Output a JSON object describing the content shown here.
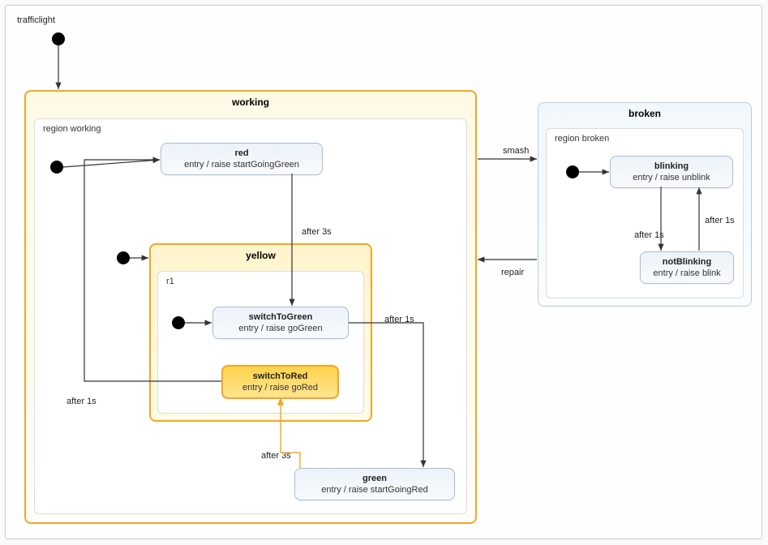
{
  "diagram": {
    "title": "trafficlight"
  },
  "working": {
    "title": "working",
    "region": "region working",
    "red": {
      "name": "red",
      "entry": "entry / raise startGoingGreen"
    },
    "yellow": {
      "title": "yellow",
      "region": "r1",
      "switchToGreen": {
        "name": "switchToGreen",
        "entry": "entry / raise goGreen"
      },
      "switchToRed": {
        "name": "switchToRed",
        "entry": "entry / raise goRed"
      }
    },
    "green": {
      "name": "green",
      "entry": "entry / raise startGoingRed"
    }
  },
  "broken": {
    "title": "broken",
    "region": "region broken",
    "blinking": {
      "name": "blinking",
      "entry": "entry / raise unblink"
    },
    "notBlinking": {
      "name": "notBlinking",
      "entry": "entry / raise blink"
    }
  },
  "transitions": {
    "red_to_yellow": "after 3s",
    "yellow_to_green": "after 1s",
    "green_to_yellow": "after 3s",
    "yellow_to_red": "after 1s",
    "working_to_broken": "smash",
    "broken_to_working": "repair",
    "blinking_to_not": "after 1s",
    "not_to_blinking": "after 1s"
  }
}
